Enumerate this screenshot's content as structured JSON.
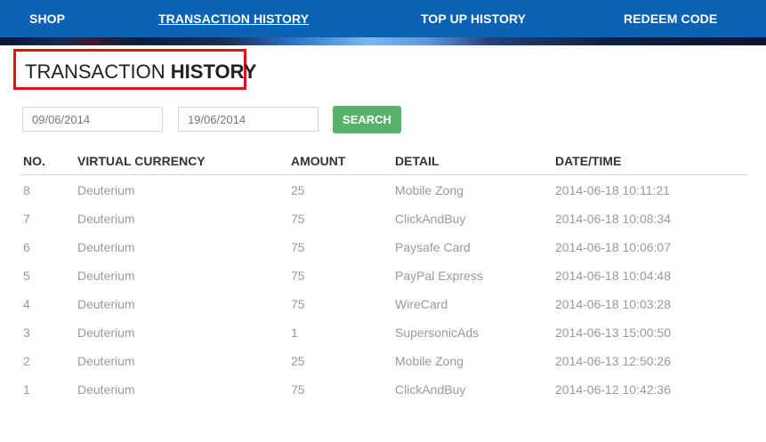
{
  "nav": {
    "items": [
      {
        "label": "SHOP"
      },
      {
        "label": "TRANSACTION HISTORY"
      },
      {
        "label": "TOP UP HISTORY"
      },
      {
        "label": "REDEEM CODE"
      }
    ]
  },
  "page": {
    "title_light": "TRANSACTION ",
    "title_bold": "HISTORY"
  },
  "filter": {
    "from_date": "09/06/2014",
    "to_date": "19/06/2014",
    "search_label": "SEARCH"
  },
  "table": {
    "headers": [
      "NO.",
      "VIRTUAL CURRENCY",
      "AMOUNT",
      "DETAIL",
      "DATE/TIME"
    ],
    "rows": [
      [
        "8",
        "Deuterium",
        "25",
        "Mobile Zong",
        "2014-06-18 10:11:21"
      ],
      [
        "7",
        "Deuterium",
        "75",
        "ClickAndBuy",
        "2014-06-18 10:08:34"
      ],
      [
        "6",
        "Deuterium",
        "75",
        "Paysafe Card",
        "2014-06-18 10:06:07"
      ],
      [
        "5",
        "Deuterium",
        "75",
        "PayPal Express",
        "2014-06-18 10:04:48"
      ],
      [
        "4",
        "Deuterium",
        "75",
        "WireCard",
        "2014-06-18 10:03:28"
      ],
      [
        "3",
        "Deuterium",
        "1",
        "SupersonicAds",
        "2014-06-13 15:00:50"
      ],
      [
        "2",
        "Deuterium",
        "25",
        "Mobile Zong",
        "2014-06-13 12:50:26"
      ],
      [
        "1",
        "Deuterium",
        "75",
        "ClickAndBuy",
        "2014-06-12 10:42:36"
      ]
    ]
  },
  "colors": {
    "nav_bg": "#0b62b5",
    "highlight_border": "#e01414",
    "search_button": "#57b26a"
  }
}
